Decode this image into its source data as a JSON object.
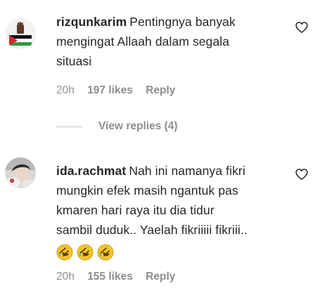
{
  "comments": [
    {
      "username": "rizqunkarim",
      "text": "Pentingnya banyak mengingat Allaah dalam segala situasi",
      "line1": "Pentingnya banyak",
      "line2": "mengingat Allaah dalam segala",
      "line3": "situasi",
      "time": "20h",
      "likes": "197 likes",
      "reply_label": "Reply",
      "view_replies": "View replies (4)",
      "avatar_icon": "raised-fist-flag-avatar",
      "like_icon": "heart-outline-icon"
    },
    {
      "username": "ida.rachmat",
      "line1": "Nah ini namanya fikri",
      "line2": "mungkin efek masih ngantuk pas",
      "line3": "kmaren hari raya itu dia tidur",
      "line4": "sambil duduk.. Yaelah fikriiiii fikriii..",
      "emojis": [
        "🤣",
        "🤣",
        "🤣"
      ],
      "time": "20h",
      "likes": "155 likes",
      "reply_label": "Reply",
      "avatar_icon": "user-photo-avatar",
      "like_icon": "heart-outline-icon"
    }
  ],
  "colors": {
    "text": "#262626",
    "secondary": "#8e8e8e",
    "emoji": "#f7c52a"
  }
}
